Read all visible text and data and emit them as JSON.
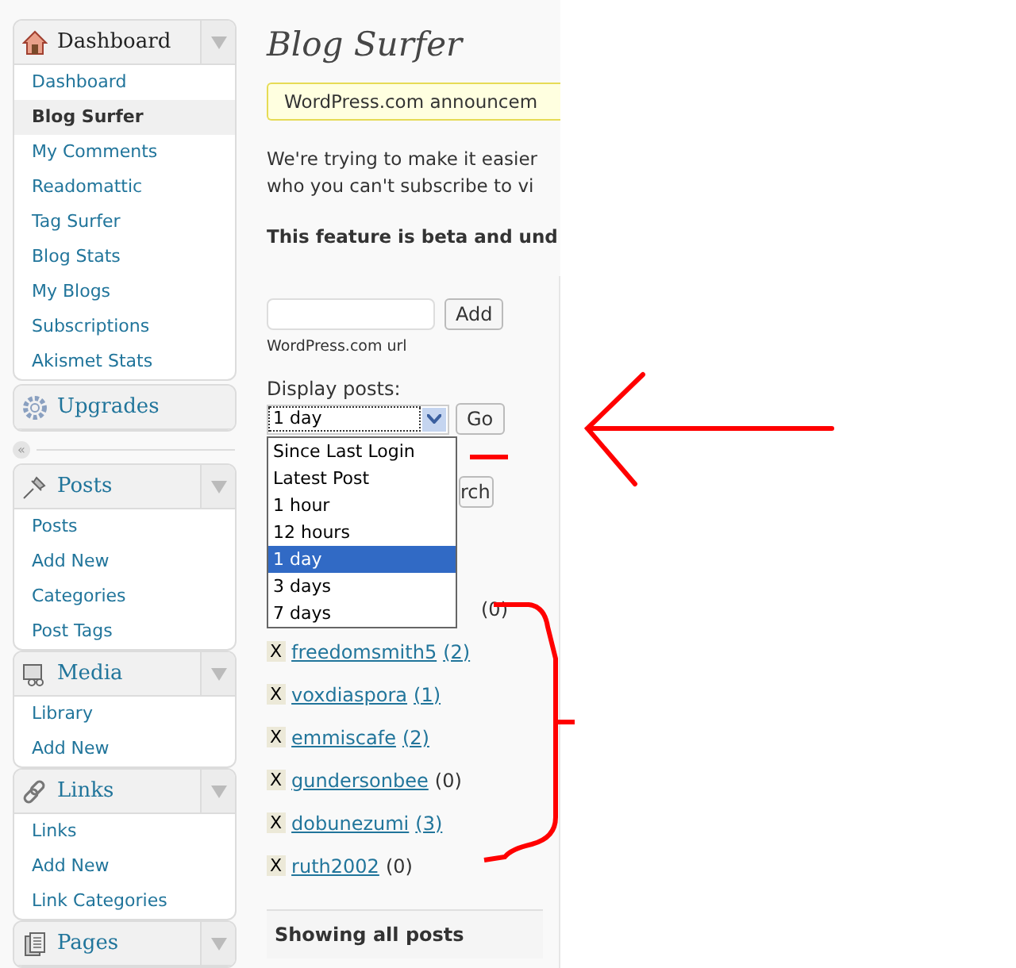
{
  "sidebar": {
    "menus": [
      {
        "title": "Dashboard",
        "collapsible": true,
        "items": [
          {
            "label": "Dashboard",
            "selected": false
          },
          {
            "label": "Blog Surfer",
            "selected": true
          },
          {
            "label": "My Comments",
            "selected": false
          },
          {
            "label": "Readomattic",
            "selected": false
          },
          {
            "label": "Tag Surfer",
            "selected": false
          },
          {
            "label": "Blog Stats",
            "selected": false
          },
          {
            "label": "My Blogs",
            "selected": false
          },
          {
            "label": "Subscriptions",
            "selected": false
          },
          {
            "label": "Akismet Stats",
            "selected": false
          }
        ]
      },
      {
        "title": "Upgrades",
        "collapsible": false
      },
      {
        "title": "Posts",
        "collapsible": true,
        "items": [
          {
            "label": "Posts",
            "selected": false
          },
          {
            "label": "Add New",
            "selected": false
          },
          {
            "label": "Categories",
            "selected": false
          },
          {
            "label": "Post Tags",
            "selected": false
          }
        ]
      },
      {
        "title": "Media",
        "collapsible": true,
        "items": [
          {
            "label": "Library",
            "selected": false
          },
          {
            "label": "Add New",
            "selected": false
          }
        ]
      },
      {
        "title": "Links",
        "collapsible": true,
        "items": [
          {
            "label": "Links",
            "selected": false
          },
          {
            "label": "Add New",
            "selected": false
          },
          {
            "label": "Link Categories",
            "selected": false
          }
        ]
      },
      {
        "title": "Pages",
        "collapsible": true
      }
    ],
    "collapse_glyph": "«"
  },
  "page": {
    "title": "Blog Surfer",
    "notice": "WordPress.com announcem",
    "intro_lines": [
      "We're trying to make it easier",
      "who you can't subscribe to vi"
    ],
    "beta_note": "This feature is beta and und",
    "url_field": {
      "hint": "WordPress.com url",
      "button": "Add"
    },
    "display": {
      "label": "Display posts:",
      "value": "1 day",
      "button": "Go",
      "options": [
        {
          "label": "Since Last Login",
          "selected": false
        },
        {
          "label": "Latest Post",
          "selected": false
        },
        {
          "label": "1 hour",
          "selected": false
        },
        {
          "label": "12 hours",
          "selected": false
        },
        {
          "label": "1 day",
          "selected": true
        },
        {
          "label": "3 days",
          "selected": false
        },
        {
          "label": "7 days",
          "selected": false
        }
      ]
    },
    "search_button": "rch",
    "blogs": [
      {
        "count": "(0)",
        "count_linked": false
      },
      {
        "remove": "X",
        "name": "freedomsmith5",
        "count": "(2)",
        "count_linked": true
      },
      {
        "remove": "X",
        "name": "voxdiaspora",
        "count": "(1)",
        "count_linked": true
      },
      {
        "remove": "X",
        "name": "emmiscafe",
        "count": "(2)",
        "count_linked": true
      },
      {
        "remove": "X",
        "name": "gundersonbee",
        "count": "(0)",
        "count_linked": false
      },
      {
        "remove": "X",
        "name": "dobunezumi",
        "count": "(3)",
        "count_linked": true
      },
      {
        "remove": "X",
        "name": "ruth2002",
        "count": "(0)",
        "count_linked": false
      }
    ],
    "footer": "Showing all posts"
  }
}
